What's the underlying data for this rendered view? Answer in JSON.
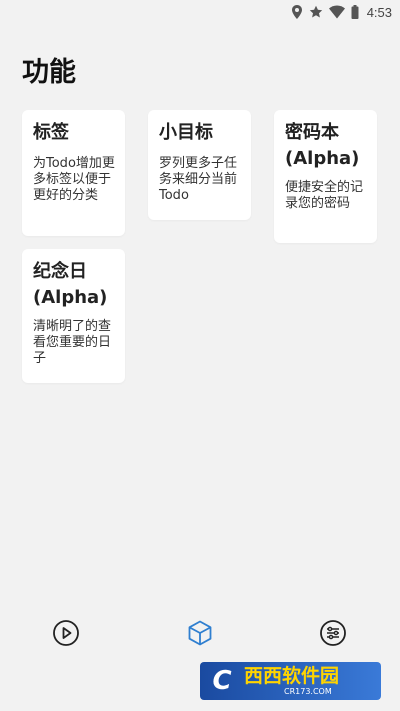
{
  "status_bar": {
    "time": "4:53",
    "icons": [
      "location-icon",
      "star-icon",
      "wifi-icon",
      "battery-icon"
    ]
  },
  "page": {
    "title": "功能"
  },
  "cards": [
    {
      "title": "标签",
      "description": "为Todo增加更多标签以便于更好的分类"
    },
    {
      "title": "小目标",
      "description": "罗列更多子任务来细分当前Todo"
    },
    {
      "title": "密码本(Alpha)",
      "description": "便捷安全的记录您的密码"
    },
    {
      "title": "纪念日(Alpha)",
      "description": "清晰明了的查看您重要的日子"
    }
  ],
  "bottom_nav": {
    "items": [
      {
        "icon": "play-circle-icon",
        "active": false
      },
      {
        "icon": "cube-icon",
        "active": true
      },
      {
        "icon": "settings-sliders-icon",
        "active": false
      }
    ],
    "active_color": "#2f7fd0",
    "inactive_color": "#222222"
  },
  "watermark": {
    "main": "西西软件园",
    "sub": "CR173.COM"
  }
}
